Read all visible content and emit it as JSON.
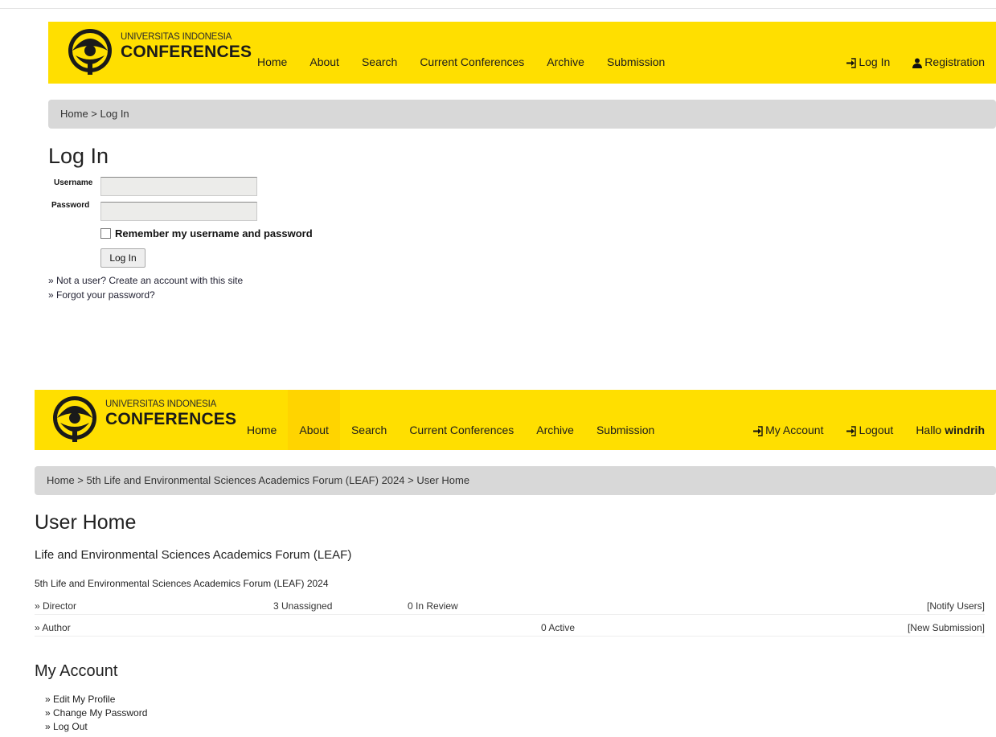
{
  "colors": {
    "nav_bg": "#ffdf00",
    "breadcrumb_bg": "#d8d8d8",
    "text": "#333333"
  },
  "brand": {
    "line1": "UNIVERSITAS INDONESIA",
    "line2": "CONFERENCES"
  },
  "nav_menu": {
    "home": "Home",
    "about": "About",
    "search": "Search",
    "current": "Current Conferences",
    "archive": "Archive",
    "submission": "Submission"
  },
  "screen1": {
    "right_menu": {
      "login": "Log In",
      "registration": "Registration"
    },
    "breadcrumb": {
      "home": "Home",
      "sep": " > ",
      "current": "Log In"
    },
    "title": "Log In",
    "form": {
      "username_label": "Username",
      "password_label": "Password",
      "username_value": "",
      "password_value": "",
      "remember_label": "Remember my username and password",
      "submit_label": "Log In"
    },
    "links": {
      "create_account": "» Not a user? Create an account with this site",
      "forgot_password": "» Forgot your password?"
    }
  },
  "screen2": {
    "right_menu": {
      "my_account": "My Account",
      "logout": "Logout",
      "hello": "Hallo",
      "username": "windrih"
    },
    "breadcrumb": {
      "home": "Home",
      "sep1": " > ",
      "conference": "5th Life and Environmental Sciences Academics Forum (LEAF) 2024",
      "sep2": " > ",
      "current": "User Home"
    },
    "title": "User Home",
    "conference_title": "Life and Environmental Sciences Academics Forum (LEAF)",
    "conference_name": "5th Life and Environmental Sciences Academics Forum (LEAF) 2024",
    "roles": [
      {
        "role": "» Director",
        "col1": "3 Unassigned",
        "col2": "0 In Review",
        "action": "[Notify Users]"
      },
      {
        "role": "» Author",
        "col1": "0 Active",
        "action": "[New Submission]"
      }
    ],
    "my_account": {
      "title": "My Account",
      "links": [
        "» Edit My Profile",
        "» Change My Password",
        "» Log Out"
      ]
    }
  }
}
